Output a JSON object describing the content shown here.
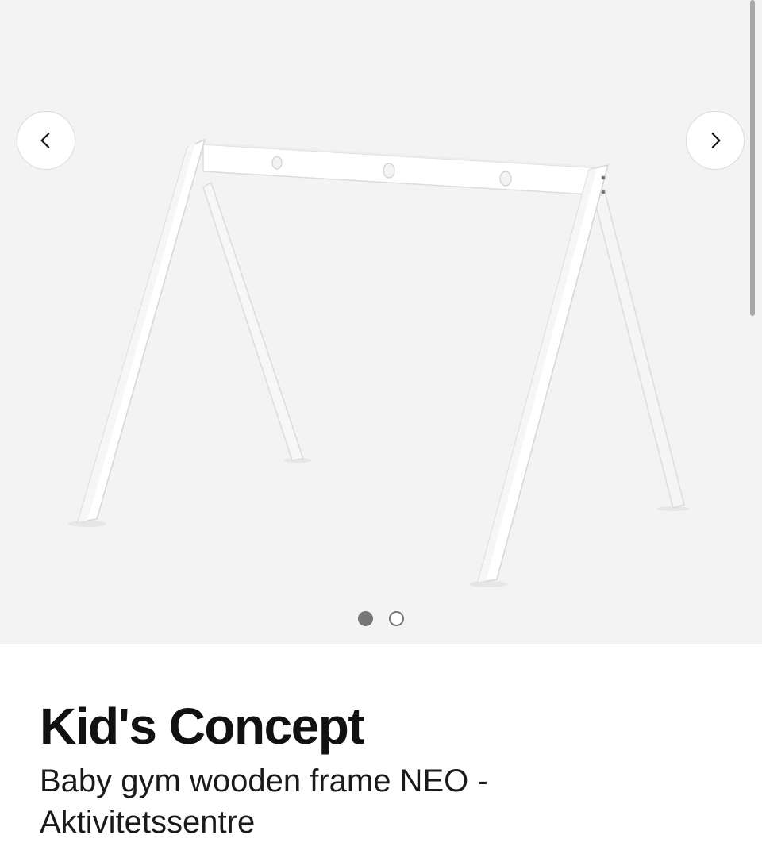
{
  "gallery": {
    "product_image": {
      "alt": "Kid's Concept Baby gym wooden frame NEO"
    },
    "prev_icon": "chevron-left-icon",
    "next_icon": "chevron-right-icon",
    "slide_count": 2,
    "active_slide": 1,
    "colors": {
      "background": "#f3f3f3",
      "dot_active": "#767676",
      "frame": "#ffffff"
    }
  },
  "product": {
    "brand": "Kid's Concept",
    "name": "Baby gym wooden frame NEO - Aktivitetssentre"
  }
}
